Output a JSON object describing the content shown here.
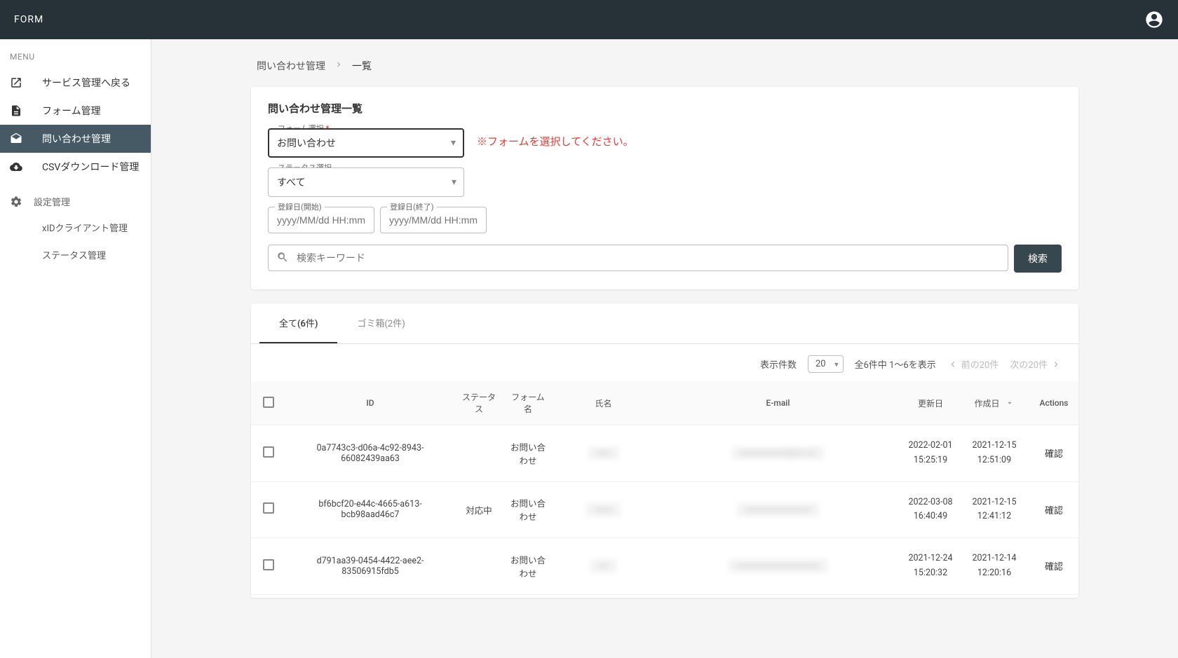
{
  "header": {
    "title": "FORM"
  },
  "sidebar": {
    "menu_label": "MENU",
    "items": [
      {
        "label": "サービス管理へ戻る"
      },
      {
        "label": "フォーム管理"
      },
      {
        "label": "問い合わせ管理"
      },
      {
        "label": "CSVダウンロード管理"
      }
    ],
    "settings_label": "設定管理",
    "sub_items": [
      {
        "label": "xIDクライアント管理"
      },
      {
        "label": "ステータス管理"
      }
    ]
  },
  "breadcrumb": {
    "root": "問い合わせ管理",
    "current": "一覧"
  },
  "filter": {
    "title": "問い合わせ管理一覧",
    "form_select_label": "フォーム選択",
    "form_select_value": "お問い合わせ",
    "form_hint": "※フォームを選択してください。",
    "status_select_label": "ステータス選択",
    "status_select_value": "すべて",
    "date_start_label": "登録日(開始)",
    "date_end_label": "登録日(終了)",
    "date_placeholder": "yyyy/MM/dd HH:mm",
    "search_placeholder": "検索キーワード",
    "search_button": "検索"
  },
  "tabs": [
    {
      "label": "全て(6件)",
      "active": true
    },
    {
      "label": "ゴミ箱(2件)",
      "active": false
    }
  ],
  "pagination": {
    "page_size_label": "表示件数",
    "page_size_value": "20",
    "range_text": "全6件中 1〜6を表示",
    "prev_label": "前の20件",
    "next_label": "次の20件"
  },
  "columns": {
    "id": "ID",
    "status": "ステータス",
    "form_name": "フォーム名",
    "name": "氏名",
    "email": "E-mail",
    "updated": "更新日",
    "created": "作成日",
    "actions": "Actions"
  },
  "rows": [
    {
      "id": "0a7743c3-d06a-4c92-8943-66082439aa63",
      "status": "",
      "form_name": "お問い合わせ",
      "name": "xxx",
      "email": "xxxxxxxxxxx@xx.xx",
      "updated_date": "2022-02-01",
      "updated_time": "15:25:19",
      "created_date": "2021-12-15",
      "created_time": "12:51:09",
      "action": "確認"
    },
    {
      "id": "bf6bcf20-e44c-4665-a613-bcb98aad46c7",
      "status": "対応中",
      "form_name": "お問い合わせ",
      "name": "xxxx",
      "email": "xxxxxxxxxxxxxxx",
      "updated_date": "2022-03-08",
      "updated_time": "16:40:49",
      "created_date": "2021-12-15",
      "created_time": "12:41:12",
      "action": "確認"
    },
    {
      "id": "d791aa39-0454-4422-aee2-83506915fdb5",
      "status": "",
      "form_name": "お問い合わせ",
      "name": "xx",
      "email": "xxxxxxxxxxxxxxxxxxx",
      "updated_date": "2021-12-24",
      "updated_time": "15:20:32",
      "created_date": "2021-12-14",
      "created_time": "12:20:16",
      "action": "確認"
    }
  ]
}
